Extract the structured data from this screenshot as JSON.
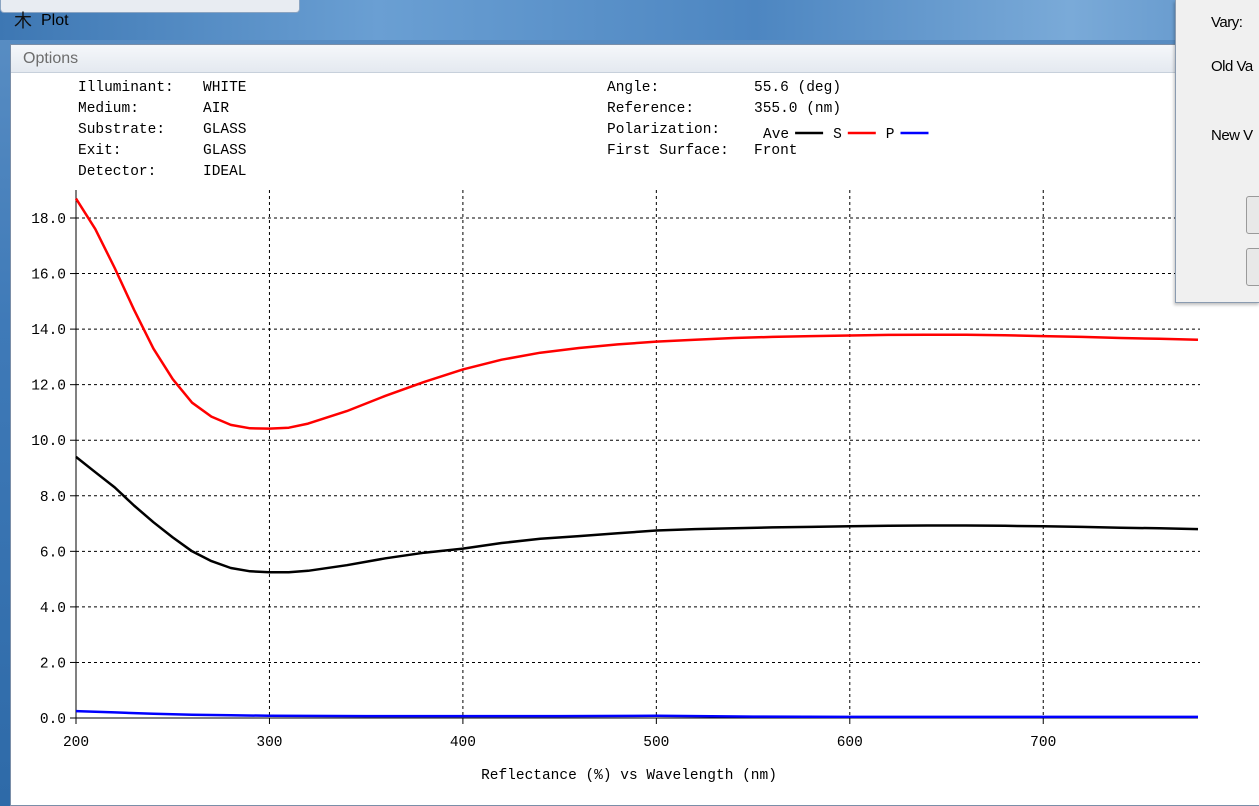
{
  "window": {
    "title": "Plot",
    "icon": "plot-app-icon"
  },
  "menu": {
    "options_label": "Options"
  },
  "info": {
    "illuminant_label": "Illuminant:",
    "illuminant_value": "WHITE",
    "medium_label": "Medium:",
    "medium_value": "AIR",
    "substrate_label": "Substrate:",
    "substrate_value": "GLASS",
    "exit_label": "Exit:",
    "exit_value": "GLASS",
    "detector_label": "Detector:",
    "detector_value": "IDEAL",
    "angle_label": "Angle:",
    "angle_value": "55.6 (deg)",
    "reference_label": "Reference:",
    "reference_value": "355.0 (nm)",
    "polarization_label": "Polarization:",
    "first_surface_label": "First Surface:",
    "first_surface_value": "Front"
  },
  "side_panel": {
    "vary_label": "Vary:",
    "old_label": "Old Va",
    "new_label": "New V"
  },
  "colors": {
    "ave": "#000000",
    "s": "#ff0000",
    "p": "#0000ff",
    "grid": "#000000"
  },
  "chart_data": {
    "type": "line",
    "xlabel": "Reflectance (%) vs Wavelength (nm)",
    "ylabel": "",
    "xlim": [
      200,
      780
    ],
    "ylim": [
      0,
      18.0
    ],
    "x_ticks": [
      200,
      300,
      400,
      500,
      600,
      700
    ],
    "y_ticks": [
      "0.0",
      "2.0",
      "4.0",
      "6.0",
      "8.0",
      "10.0",
      "12.0",
      "14.0",
      "16.0",
      "18.0"
    ],
    "grid": true,
    "legend": {
      "placement": "top",
      "prefix": "Polarization:"
    },
    "series": [
      {
        "name": "Ave",
        "color": "#000000",
        "x": [
          200,
          210,
          220,
          230,
          240,
          250,
          260,
          270,
          280,
          290,
          300,
          310,
          320,
          340,
          360,
          380,
          400,
          420,
          440,
          460,
          480,
          500,
          520,
          540,
          560,
          580,
          600,
          620,
          640,
          660,
          680,
          700,
          720,
          740,
          760,
          780
        ],
        "y": [
          9.4,
          8.85,
          8.3,
          7.65,
          7.05,
          6.5,
          6.0,
          5.65,
          5.4,
          5.28,
          5.25,
          5.25,
          5.3,
          5.5,
          5.75,
          5.95,
          6.1,
          6.3,
          6.45,
          6.55,
          6.65,
          6.75,
          6.8,
          6.83,
          6.86,
          6.88,
          6.9,
          6.92,
          6.93,
          6.93,
          6.92,
          6.9,
          6.88,
          6.85,
          6.83,
          6.8
        ]
      },
      {
        "name": "S",
        "color": "#ff0000",
        "x": [
          200,
          210,
          220,
          230,
          240,
          250,
          260,
          270,
          280,
          290,
          300,
          310,
          320,
          340,
          360,
          380,
          400,
          420,
          440,
          460,
          480,
          500,
          520,
          540,
          560,
          580,
          600,
          620,
          640,
          660,
          680,
          700,
          720,
          740,
          760,
          780
        ],
        "y": [
          18.7,
          17.6,
          16.2,
          14.7,
          13.3,
          12.2,
          11.35,
          10.85,
          10.55,
          10.43,
          10.42,
          10.45,
          10.6,
          11.05,
          11.6,
          12.1,
          12.55,
          12.9,
          13.15,
          13.32,
          13.45,
          13.55,
          13.62,
          13.68,
          13.72,
          13.75,
          13.77,
          13.79,
          13.8,
          13.8,
          13.78,
          13.75,
          13.72,
          13.68,
          13.65,
          13.62
        ]
      },
      {
        "name": "P",
        "color": "#0000ff",
        "x": [
          200,
          220,
          240,
          260,
          280,
          300,
          350,
          400,
          450,
          500,
          550,
          600,
          650,
          700,
          780
        ],
        "y": [
          0.25,
          0.2,
          0.15,
          0.12,
          0.1,
          0.08,
          0.07,
          0.07,
          0.07,
          0.08,
          0.05,
          0.04,
          0.04,
          0.04,
          0.04
        ]
      }
    ]
  }
}
